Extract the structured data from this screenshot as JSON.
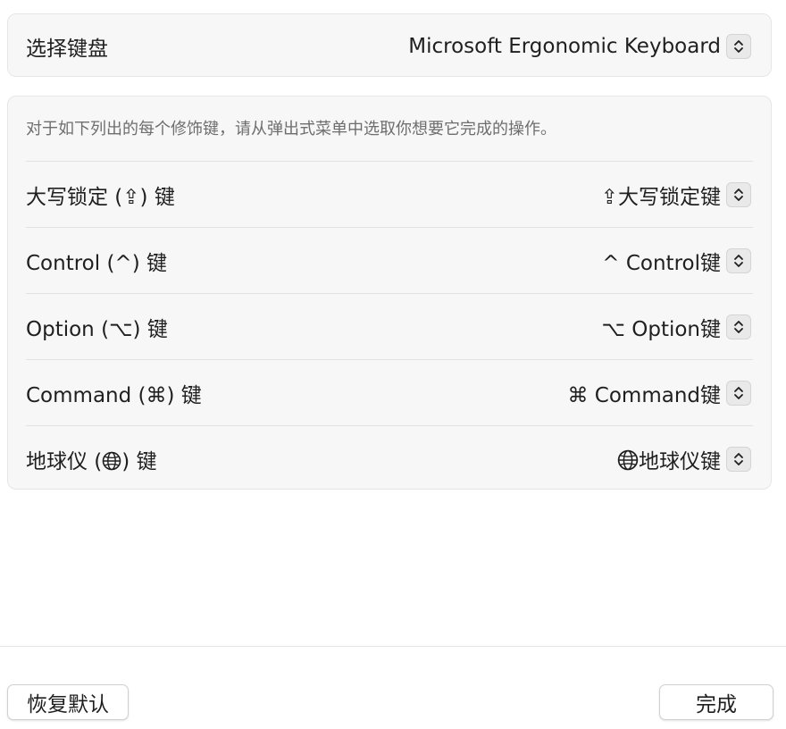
{
  "keyboard_select": {
    "label": "选择键盘",
    "value": "Microsoft Ergonomic Keyboard"
  },
  "modifiers": {
    "description": "对于如下列出的每个修饰键，请从弹出式菜单中选取你想要它完成的操作。",
    "rows": [
      {
        "label": "大写锁定 (⇪) 键",
        "value": "⇪大写锁定键"
      },
      {
        "label": "Control (^) 键",
        "value": "^ Control键"
      },
      {
        "label": "Option (⌥) 键",
        "value": "⌥ Option键"
      },
      {
        "label": "Command (⌘) 键",
        "value": "⌘ Command键"
      },
      {
        "label_prefix": "地球仪 (",
        "label_suffix": ") 键",
        "value": "地球仪键",
        "icon": "globe-icon"
      }
    ]
  },
  "footer": {
    "restore_label": "恢复默认",
    "done_label": "完成"
  }
}
